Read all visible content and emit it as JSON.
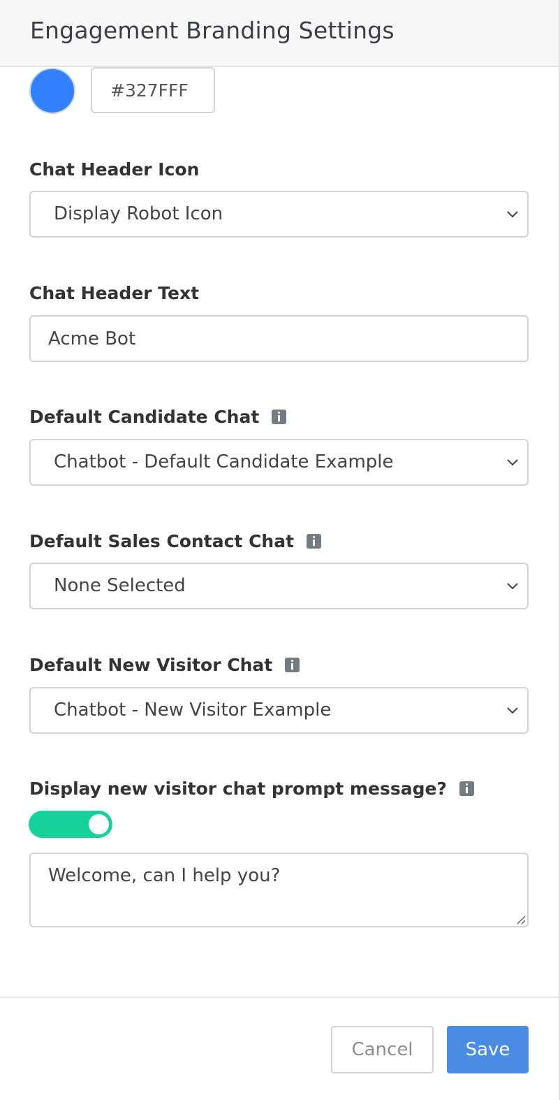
{
  "modal": {
    "title": "Engagement Branding Settings"
  },
  "brand_color": {
    "hex_value": "#327FFF",
    "swatch_color": "#327FFF"
  },
  "chat_header_icon": {
    "label": "Chat Header Icon",
    "selected": "Display Robot Icon",
    "icon": "chevron-down-icon"
  },
  "chat_header_text": {
    "label": "Chat Header Text",
    "value": "Acme Bot"
  },
  "default_candidate_chat": {
    "label": "Default Candidate Chat",
    "info_icon": "info-icon",
    "selected": "Chatbot - Default Candidate Example"
  },
  "default_sales_contact_chat": {
    "label": "Default Sales Contact Chat",
    "info_icon": "info-icon",
    "selected": "None Selected"
  },
  "default_new_visitor_chat": {
    "label": "Default New Visitor Chat",
    "info_icon": "info-icon",
    "selected": "Chatbot - New Visitor Example"
  },
  "prompt_message": {
    "label": "Display new visitor chat prompt message?",
    "info_icon": "info-icon",
    "toggle_on": true,
    "toggle_color": "#16D19A",
    "message": "Welcome, can I help you?"
  },
  "footer": {
    "cancel_label": "Cancel",
    "save_label": "Save",
    "save_color": "#4A8BE3"
  }
}
